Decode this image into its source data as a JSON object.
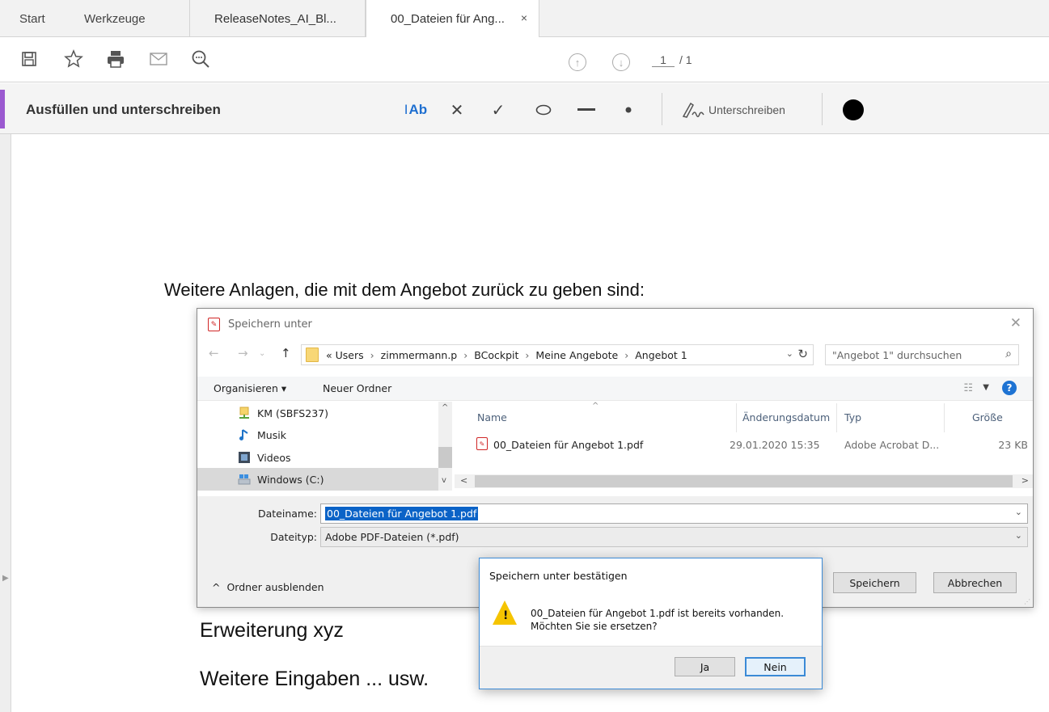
{
  "tabs": {
    "start": "Start",
    "tools": "Werkzeuge",
    "doc1": "ReleaseNotes_AI_Bl...",
    "doc2": "00_Dateien für Ang...",
    "close": "×"
  },
  "toolbar": {
    "page_current": "1",
    "page_total": "/ 1"
  },
  "fill_sign": {
    "title": "Ausfüllen und unterschreiben",
    "text_tool": "Ab",
    "sign_label": "Unterschreiben",
    "accent_color": "#9b59d0"
  },
  "document": {
    "heading": "Weitere Anlagen, die mit dem Angebot zurück zu geben sind:",
    "line2": "Erweiterung xyz",
    "line3": "Weitere Eingaben ... usw."
  },
  "save_dialog": {
    "title": "Speichern unter",
    "breadcrumb": [
      "«",
      "Users",
      "zimmermann.p",
      "BCockpit",
      "Meine Angebote",
      "Angebot 1"
    ],
    "search_placeholder": "\"Angebot 1\" durchsuchen",
    "organize": "Organisieren ▾",
    "new_folder": "Neuer Ordner",
    "tree": [
      {
        "label": "KM (SBFS237)",
        "icon": "network-drive-icon"
      },
      {
        "label": "Musik",
        "icon": "music-icon"
      },
      {
        "label": "Videos",
        "icon": "video-icon"
      },
      {
        "label": "Windows (C:)",
        "icon": "drive-icon",
        "selected": true
      }
    ],
    "columns": {
      "name": "Name",
      "modified": "Änderungsdatum",
      "type": "Typ",
      "size": "Größe"
    },
    "files": [
      {
        "name": "00_Dateien für Angebot 1.pdf",
        "modified": "29.01.2020 15:35",
        "type": "Adobe Acrobat D...",
        "size": "23 KB"
      }
    ],
    "filename_label": "Dateiname:",
    "filename_value": "00_Dateien für Angebot 1.pdf",
    "filetype_label": "Dateityp:",
    "filetype_value": "Adobe PDF-Dateien (*.pdf)",
    "hide_folders": "Ordner ausblenden",
    "save_button": "Speichern",
    "cancel_button": "Abbrechen"
  },
  "confirm_dialog": {
    "title": "Speichern unter bestätigen",
    "message_line1": "00_Dateien für Angebot 1.pdf ist bereits vorhanden.",
    "message_line2": "Möchten Sie sie ersetzen?",
    "yes_button": "Ja",
    "no_button": "Nein",
    "warning_color": "#f5c400"
  }
}
